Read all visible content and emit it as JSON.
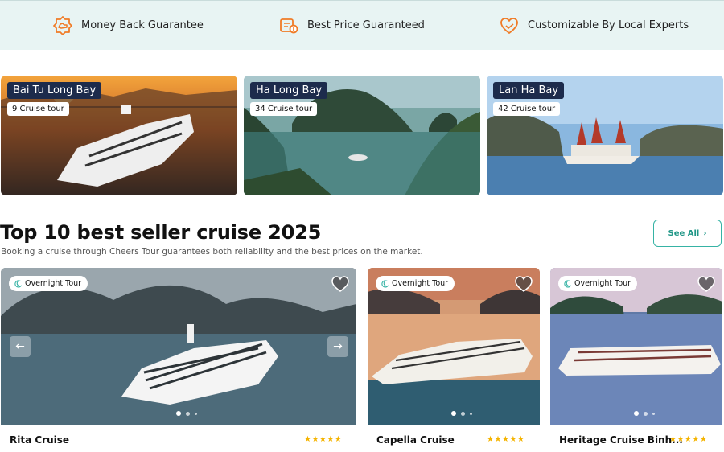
{
  "guarantees": [
    {
      "label": "Money Back Guarantee",
      "icon": "hand-coin-icon"
    },
    {
      "label": "Best Price Guaranteed",
      "icon": "price-tag-icon"
    },
    {
      "label": "Customizable By Local Experts",
      "icon": "heart-hand-icon"
    }
  ],
  "destinations": [
    {
      "title": "Bai Tu Long Bay",
      "count": "9 Cruise tour"
    },
    {
      "title": "Ha Long Bay",
      "count": "34 Cruise tour"
    },
    {
      "title": "Lan Ha Bay",
      "count": "42 Cruise tour"
    }
  ],
  "section": {
    "title": "Top 10 best seller cruise 2025",
    "subtitle": "Booking a cruise through Cheers Tour guarantees both reliability and the best prices on the market.",
    "see_all": "See All",
    "see_all_arrow": "›"
  },
  "cruises": [
    {
      "badge": "Overnight Tour",
      "name": "Rita Cruise",
      "stars": "★★★★★",
      "prev_arrow": "←",
      "next_arrow": "→"
    },
    {
      "badge": "Overnight Tour",
      "name": "Capella Cruise",
      "stars": "★★★★★"
    },
    {
      "badge": "Overnight Tour",
      "name": "Heritage Cruise Binh...",
      "stars": "★★★★★"
    }
  ],
  "colors": {
    "accent": "#f07b26",
    "teal": "#36b3a5",
    "navy_label": "#1d2b4c",
    "star": "#f5b400"
  }
}
